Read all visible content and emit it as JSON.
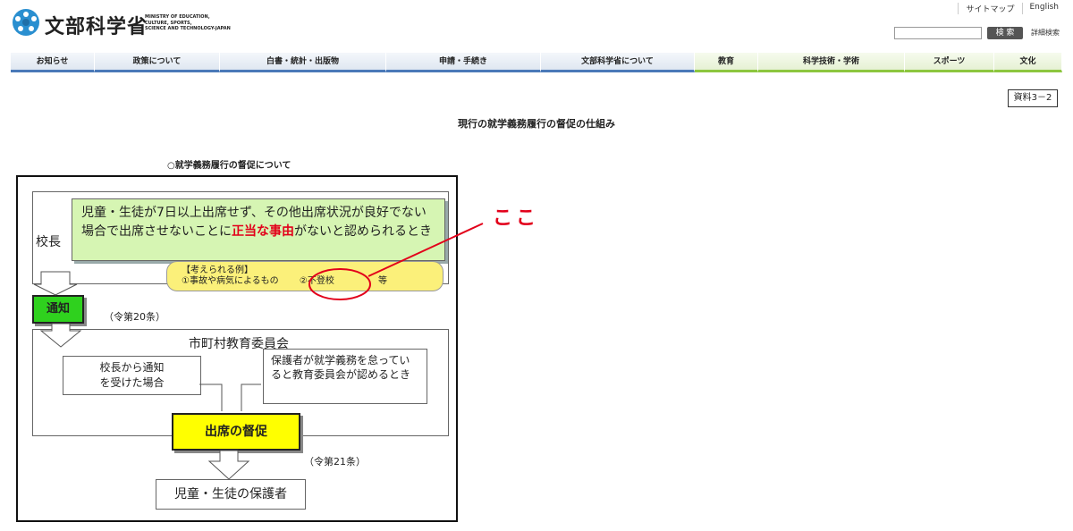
{
  "header": {
    "logo_jp": "文部科学省",
    "logo_en": [
      "MINISTRY OF EDUCATION,",
      "CULTURE, SPORTS,",
      "SCIENCE AND TECHNOLOGY-JAPAN"
    ],
    "util_links": [
      "サイトマップ",
      "English"
    ],
    "search_placeholder": "",
    "search_button": "検 索",
    "advanced_search": "詳細検索"
  },
  "nav": [
    {
      "label": "お知らせ",
      "theme": "blue"
    },
    {
      "label": "政策について",
      "theme": "blue"
    },
    {
      "label": "白書・統計・出版物",
      "theme": "blue"
    },
    {
      "label": "申請・手続き",
      "theme": "blue"
    },
    {
      "label": "文部科学省について",
      "theme": "blue"
    },
    {
      "label": "教育",
      "theme": "green"
    },
    {
      "label": "科学技術・学術",
      "theme": "green"
    },
    {
      "label": "スポーツ",
      "theme": "green"
    },
    {
      "label": "文化",
      "theme": "green"
    }
  ],
  "main": {
    "doc_no": "資料3－2",
    "title": "現行の就学義務履行の督促の仕組み",
    "section_heading": "○就学義務履行の督促について"
  },
  "diagram": {
    "principal": "校長",
    "condition_before": "児童・生徒が7日以上出席せず、その他出席状況が良好でない場合で出席させないことに",
    "condition_emph": "正当な事由",
    "condition_after": "がないと認められるとき",
    "examples_header": "【考えられる例】",
    "example_1": "①事故や病気によるもの",
    "example_2": "②不登校",
    "examples_etc": "等",
    "notify": "通知",
    "notify_law": "（令第20条）",
    "board": "市町村教育委員会",
    "from_principal_line1": "校長から通知",
    "from_principal_line2": "を受けた場合",
    "guardian_neglect": "保護者が就学義務を怠っていると教育委員会が認めるとき",
    "attendance": "出席の督促",
    "attend_law": "（令第21条）",
    "guardian": "児童・生徒の保護者"
  },
  "annotation": {
    "label": "ここ",
    "color": "#e2001a"
  }
}
